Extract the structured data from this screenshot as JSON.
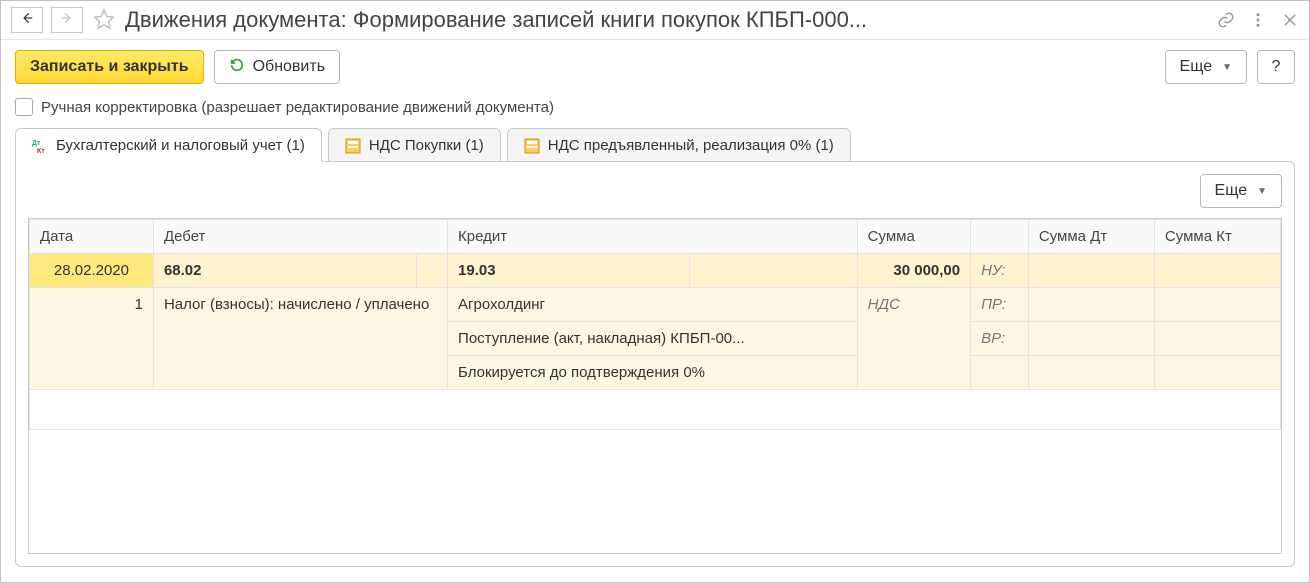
{
  "titlebar": {
    "title": "Движения документа: Формирование записей книги покупок КПБП-000..."
  },
  "toolbar": {
    "save_close": "Записать и закрыть",
    "refresh": "Обновить",
    "more": "Еще",
    "help": "?"
  },
  "checkbox": {
    "label": "Ручная корректировка (разрешает редактирование движений документа)"
  },
  "tabs": [
    {
      "label": "Бухгалтерский и налоговый учет (1)"
    },
    {
      "label": "НДС Покупки (1)"
    },
    {
      "label": "НДС предъявленный, реализация 0% (1)"
    }
  ],
  "tab_toolbar": {
    "more": "Еще"
  },
  "table": {
    "headers": {
      "date": "Дата",
      "debit": "Дебет",
      "credit": "Кредит",
      "sum": "Сумма",
      "sum_dt": "Сумма Дт",
      "sum_kt": "Сумма Кт"
    },
    "row_main": {
      "date": "28.02.2020",
      "debit_acc": "68.02",
      "credit_acc": "19.03",
      "sum": "30 000,00",
      "tag_nu": "НУ:"
    },
    "row_sub": {
      "line_no": "1",
      "debit_desc": "Налог (взносы): начислено / уплачено",
      "credit_line1": "Агрохолдинг",
      "credit_line2": "Поступление (акт, накладная) КПБП-00...",
      "credit_line3": "Блокируется до подтверждения 0%",
      "sum_label": "НДС",
      "tag_pr": "ПР:",
      "tag_vr": "ВР:"
    }
  }
}
